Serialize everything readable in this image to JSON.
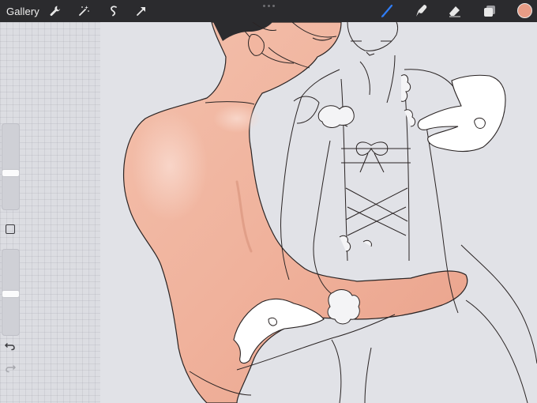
{
  "toolbar": {
    "gallery_label": "Gallery",
    "left_tools": [
      "wrench-icon",
      "magic-wand-icon",
      "selection-icon",
      "transform-arrow-icon"
    ],
    "right_tools": [
      "brush-icon",
      "smudge-icon",
      "eraser-icon",
      "layers-icon"
    ],
    "active_tool": "brush-icon",
    "active_color": "#e79c86",
    "accent": "#2f7df6"
  },
  "sidebar": {
    "brush_size_level": 0.42,
    "opacity_level": 0.48,
    "controls": [
      "modify-square-button",
      "undo-icon",
      "redo-icon"
    ]
  }
}
